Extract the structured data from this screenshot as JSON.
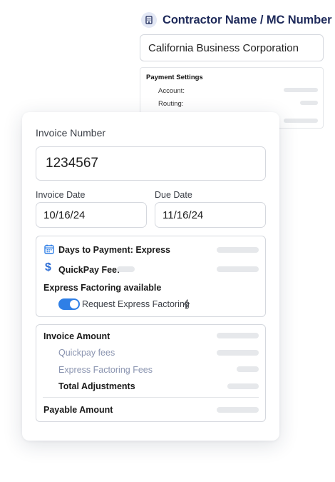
{
  "contractor": {
    "title": "Contractor Name / MC Number",
    "name_value": "California Business Corporation",
    "payment_settings": {
      "title": "Payment Settings",
      "account_label": "Account:",
      "routing_label": "Routing:"
    }
  },
  "invoice": {
    "number_label": "Invoice Number",
    "number_value": "1234567",
    "invoice_date_label": "Invoice Date",
    "invoice_date_value": "10/16/24",
    "due_date_label": "Due Date",
    "due_date_value": "11/16/24"
  },
  "payment": {
    "days_label": "Days to Payment: Express",
    "quickpay_label": "QuickPay Fee:",
    "factoring_available": "Express Factoring available",
    "request_factoring_label": "Request Express Factoring",
    "request_factoring_on": true
  },
  "amounts": {
    "invoice_amount": "Invoice Amount",
    "quickpay_fees": "Quickpay fees",
    "express_factoring_fees": "Express Factoring Fees",
    "total_adjustments": "Total Adjustments",
    "payable_amount": "Payable Amount"
  },
  "colors": {
    "accent": "#2f7fe6",
    "title_navy": "#1e2a5a",
    "muted_text": "#8a94b0",
    "placeholder_bar": "#e6e8eb"
  },
  "icons": {
    "contractor": "building-icon",
    "days": "calendar-icon",
    "quickpay": "dollar-icon",
    "factoring": "bolt-icon"
  }
}
